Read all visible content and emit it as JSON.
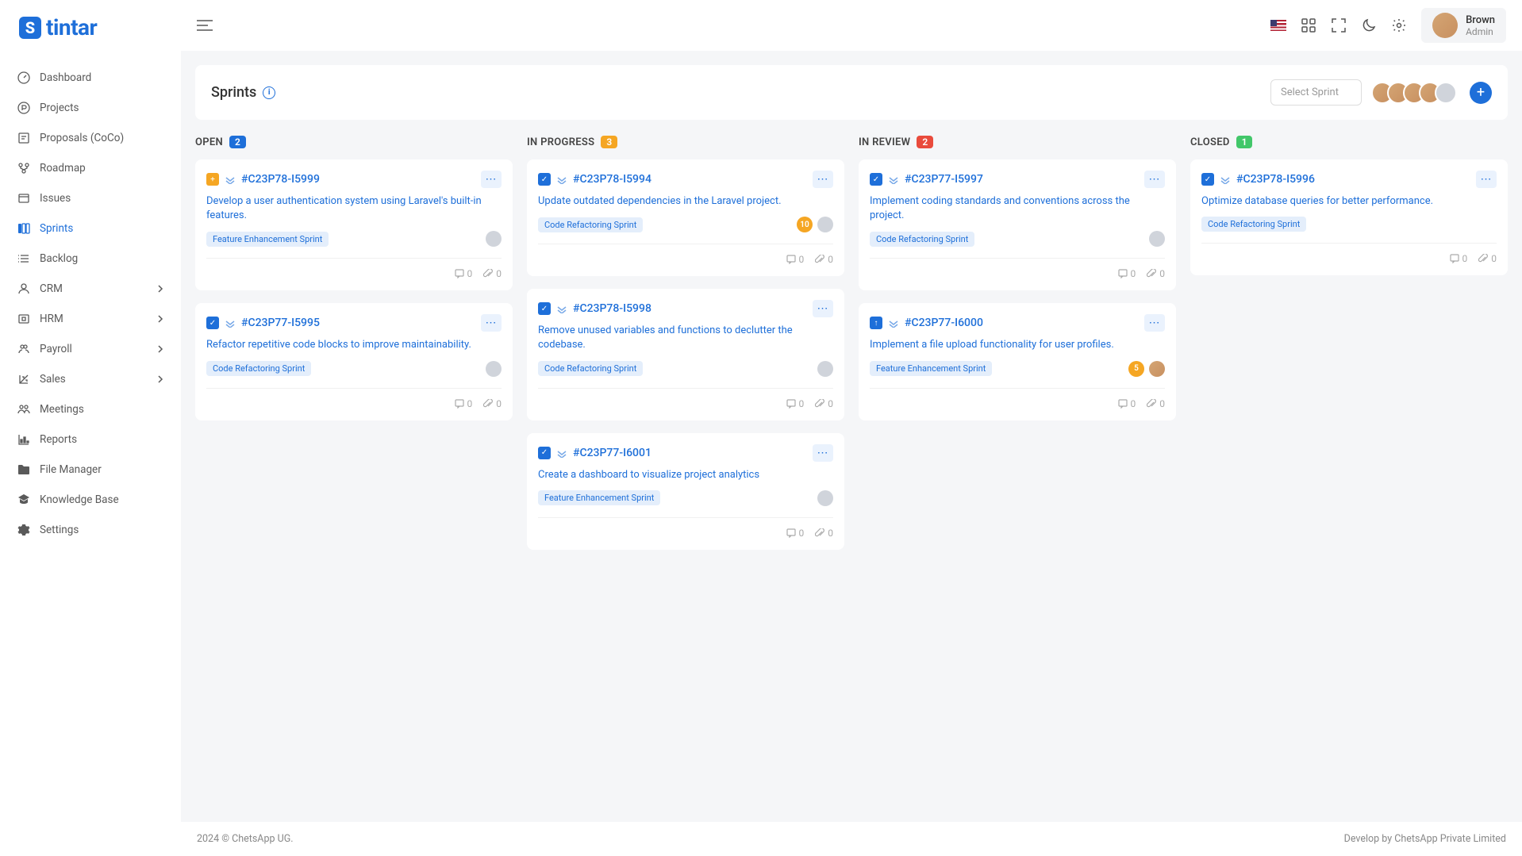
{
  "brand": "tintar",
  "user": {
    "name": "Brown",
    "role": "Admin"
  },
  "nav": [
    {
      "label": "Dashboard",
      "icon": "gauge"
    },
    {
      "label": "Projects",
      "icon": "p-circle"
    },
    {
      "label": "Proposals (CoCo)",
      "icon": "proposal"
    },
    {
      "label": "Roadmap",
      "icon": "roadmap"
    },
    {
      "label": "Issues",
      "icon": "issues"
    },
    {
      "label": "Sprints",
      "icon": "sprints",
      "active": true
    },
    {
      "label": "Backlog",
      "icon": "backlog"
    },
    {
      "label": "CRM",
      "icon": "crm",
      "chevron": true
    },
    {
      "label": "HRM",
      "icon": "hrm",
      "chevron": true
    },
    {
      "label": "Payroll",
      "icon": "payroll",
      "chevron": true
    },
    {
      "label": "Sales",
      "icon": "sales",
      "chevron": true
    },
    {
      "label": "Meetings",
      "icon": "meetings"
    },
    {
      "label": "Reports",
      "icon": "reports"
    },
    {
      "label": "File Manager",
      "icon": "folder"
    },
    {
      "label": "Knowledge Base",
      "icon": "grad-cap"
    },
    {
      "label": "Settings",
      "icon": "gear"
    }
  ],
  "page": {
    "title": "Sprints",
    "select_placeholder": "Select Sprint"
  },
  "columns": [
    {
      "title": "OPEN",
      "count": "2",
      "badge": "blue",
      "cards": [
        {
          "type": "feat",
          "id": "#C23P78-I5999",
          "desc": "Develop a user authentication system using Laravel's built-in features.",
          "tag": "Feature Enhancement Sprint",
          "comments": "0",
          "attach": "0"
        },
        {
          "type": "task",
          "id": "#C23P77-I5995",
          "desc": "Refactor repetitive code blocks to improve maintainability.",
          "tag": "Code Refactoring Sprint",
          "comments": "0",
          "attach": "0"
        }
      ]
    },
    {
      "title": "IN PROGRESS",
      "count": "3",
      "badge": "orange",
      "cards": [
        {
          "type": "task",
          "id": "#C23P78-I5994",
          "desc": "Update outdated dependencies in the Laravel project.",
          "tag": "Code Refactoring Sprint",
          "points": "10",
          "comments": "0",
          "attach": "0"
        },
        {
          "type": "task",
          "id": "#C23P78-I5998",
          "desc": "Remove unused variables and functions to declutter the codebase.",
          "tag": "Code Refactoring Sprint",
          "comments": "0",
          "attach": "0"
        },
        {
          "type": "task",
          "id": "#C23P77-I6001",
          "desc": "Create a dashboard to visualize project analytics",
          "tag": "Feature Enhancement Sprint",
          "comments": "0",
          "attach": "0"
        }
      ]
    },
    {
      "title": "IN REVIEW",
      "count": "2",
      "badge": "red",
      "cards": [
        {
          "type": "task",
          "id": "#C23P77-I5997",
          "desc": "Implement coding standards and conventions across the project.",
          "tag": "Code Refactoring Sprint",
          "comments": "0",
          "attach": "0"
        },
        {
          "type": "bug",
          "id": "#C23P77-I6000",
          "desc": "Implement a file upload functionality for user profiles.",
          "tag": "Feature Enhancement Sprint",
          "points": "5",
          "real": true,
          "comments": "0",
          "attach": "0"
        }
      ]
    },
    {
      "title": "CLOSED",
      "count": "1",
      "badge": "green",
      "cards": [
        {
          "type": "task",
          "id": "#C23P78-I5996",
          "desc": "Optimize database queries for better performance.",
          "tag": "Code Refactoring Sprint",
          "noassignee": true,
          "comments": "0",
          "attach": "0"
        }
      ]
    }
  ],
  "footer": {
    "left": "2024 © ChetsApp UG.",
    "right": "Develop by ChetsApp Private Limited"
  }
}
